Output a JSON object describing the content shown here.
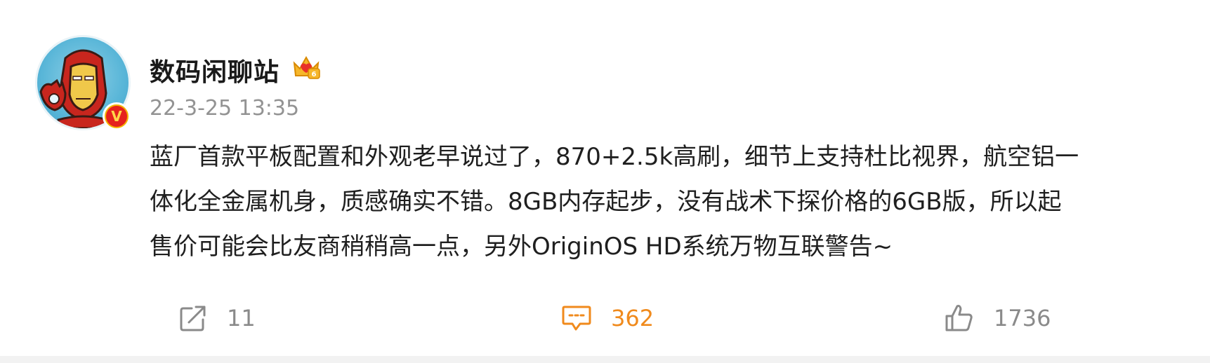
{
  "post": {
    "author": {
      "name": "数码闲聊站",
      "avatar_icon": "iron-man-avatar-icon",
      "verified_badge": "V",
      "member_icon": "crown-membership-icon"
    },
    "timestamp": "22-3-25 13:35",
    "content_lines": [
      "蓝厂首款平板配置和外观老早说过了，870+2.5k高刷，细节上支持杜比视界，航空铝一",
      "体化全金属机身，质感确实不错。8GB内存起步，没有战术下探价格的6GB版，所以起",
      "售价可能会比友商稍稍高一点，另外OriginOS HD系统万物互联警告~"
    ],
    "actions": {
      "repost": {
        "icon": "share-icon",
        "count": "11"
      },
      "comment": {
        "icon": "comment-icon",
        "count": "362",
        "color": "#f08a1c"
      },
      "like": {
        "icon": "thumbs-up-icon",
        "count": "1736"
      }
    }
  }
}
